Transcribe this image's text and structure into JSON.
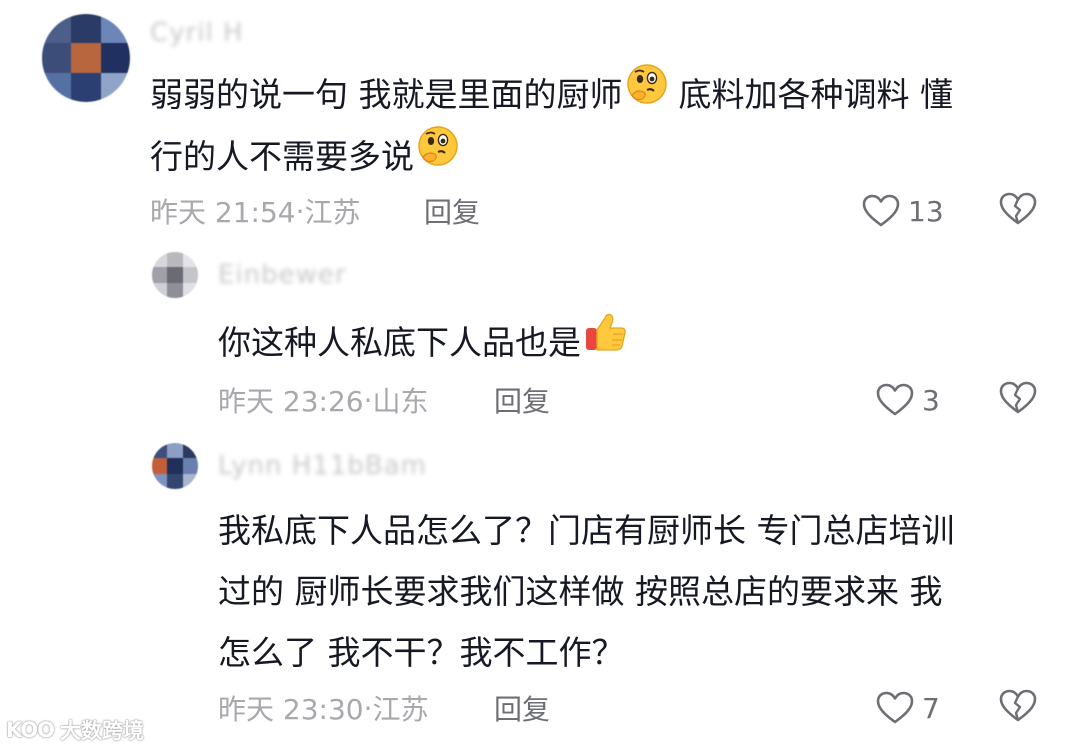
{
  "comments": [
    {
      "username": "Cyril H",
      "text_line1_part1": "弱弱的说一句 我就是里面的厨师",
      "text_line1_part2": "底料加各种调料 懂",
      "text_line2": "行的人不需要多说",
      "timestamp": "昨天 21:54",
      "location": "江苏",
      "reply_label": "回复",
      "likes": "13"
    },
    {
      "username": "Einbewer",
      "text_line1": "你这种人私底下人品也是",
      "timestamp": "昨天 23:26",
      "location": "山东",
      "reply_label": "回复",
      "likes": "3"
    },
    {
      "username": "Lynn H11bBam",
      "text_line1": "我私底下人品怎么了？门店有厨师长 专门总店培训",
      "text_line2": "过的 厨师长要求我们这样做  按照总店的要求来 我",
      "text_line3": "怎么了 我不干？我不工作？",
      "timestamp": "昨天 23:30",
      "location": "江苏",
      "reply_label": "回复",
      "likes": "7"
    }
  ],
  "watermark": {
    "logo": "KOO",
    "text": "大数跨境"
  },
  "icons": {
    "like": "heart-outline-icon",
    "dislike": "broken-heart-icon",
    "thinking_emoji": "thinking-face-emoji",
    "thumbs_up_emoji": "thumbs-up-emoji"
  },
  "colors": {
    "text": "#161823",
    "meta": "#a8a8ad",
    "icon": "#6e6f75"
  }
}
